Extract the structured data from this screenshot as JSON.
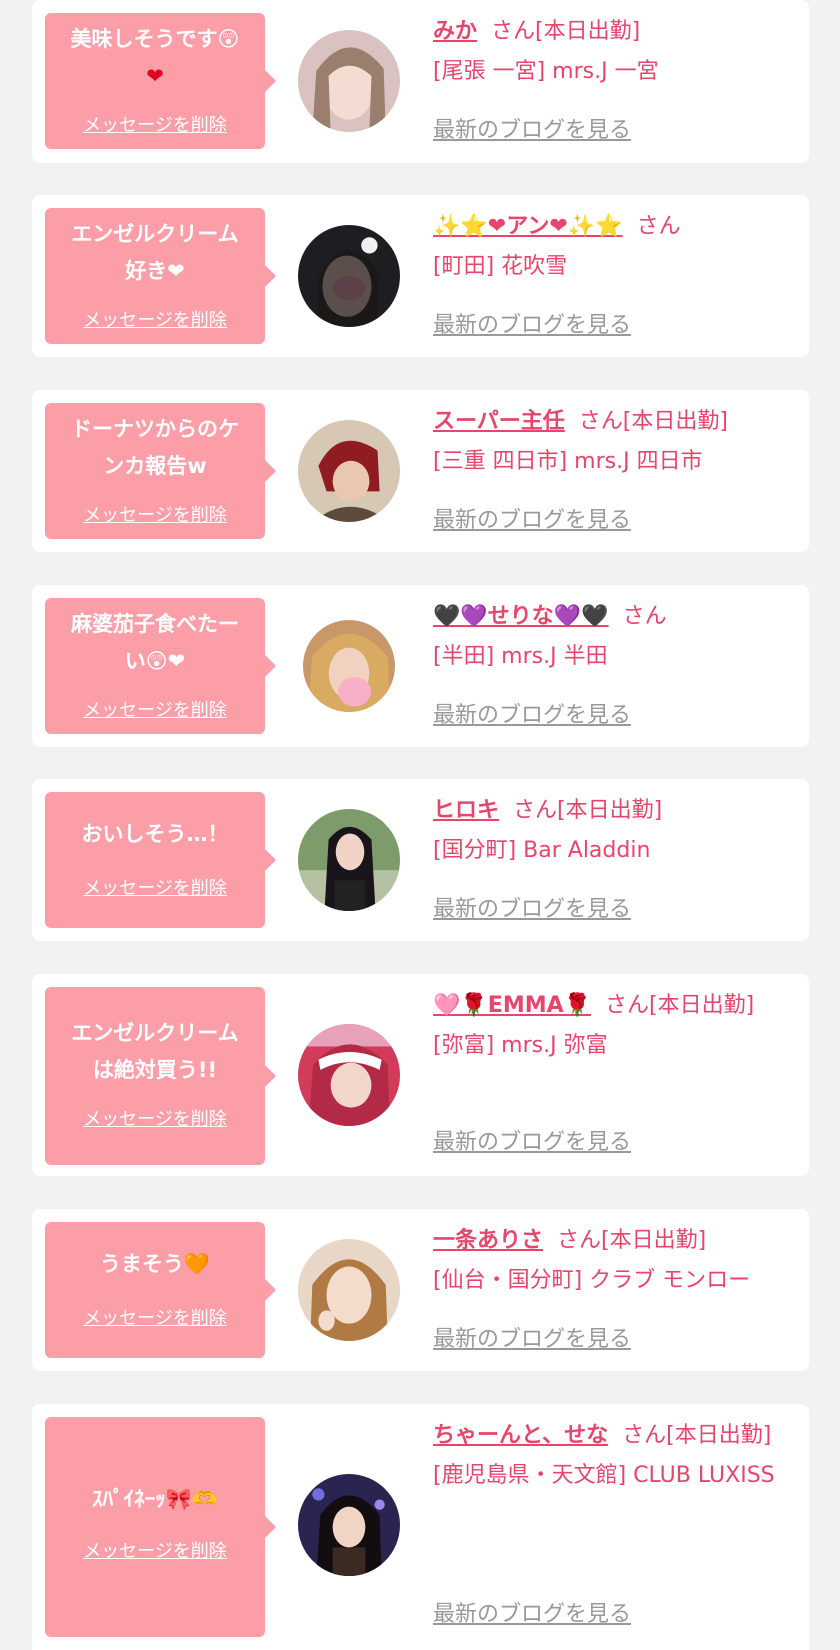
{
  "colors": {
    "page_bg": "#f2f2f2",
    "card_bg": "#ffffff",
    "bubble_bg": "#fc9ea8",
    "name_color": "#e8456b",
    "blog_link_color": "#999999"
  },
  "messages": [
    {
      "comment_lines": [
        "美味しそうです😲",
        "❤"
      ],
      "delete_label": "メッセージを削除",
      "name": "みか",
      "suffix": "さん[本日出勤]",
      "shop_lines": [
        "[尾張 一宮] mrs.J 一宮"
      ],
      "blog_label": "最新のブログを見る",
      "avatar_icon": "avatar-photo"
    },
    {
      "comment_lines": [
        "エンゼルクリーム",
        "好き❤"
      ],
      "delete_label": "メッセージを削除",
      "name": "✨⭐❤アン❤✨⭐",
      "suffix": "さん",
      "shop_lines": [
        "[町田] 花吹雪"
      ],
      "blog_label": "最新のブログを見る",
      "avatar_icon": "avatar-photo"
    },
    {
      "comment_lines": [
        "ドーナツからのケ",
        "ンカ報告w"
      ],
      "delete_label": "メッセージを削除",
      "name": "スーパー主任",
      "suffix": "さん[本日出勤]",
      "shop_lines": [
        "[三重 四日市] mrs.J 四日市"
      ],
      "blog_label": "最新のブログを見る",
      "avatar_icon": "avatar-photo"
    },
    {
      "comment_lines": [
        "麻婆茄子食べたー",
        "い😲❤"
      ],
      "delete_label": "メッセージを削除",
      "name": "🖤💜せりな💜🖤",
      "suffix": "さん",
      "shop_lines": [
        "[半田] mrs.J 半田"
      ],
      "blog_label": "最新のブログを見る",
      "avatar_icon": "avatar-photo"
    },
    {
      "comment_lines": [
        "おいしそう…！"
      ],
      "delete_label": "メッセージを削除",
      "name": "ヒロキ",
      "suffix": "さん[本日出勤]",
      "shop_lines": [
        "[国分町] Bar Aladdin"
      ],
      "blog_label": "最新のブログを見る",
      "avatar_icon": "avatar-photo"
    },
    {
      "comment_lines": [
        "エンゼルクリーム",
        "は絶対買う!!"
      ],
      "delete_label": "メッセージを削除",
      "name": "🩷🌹EMMA🌹",
      "suffix": "さん[本日出勤]",
      "shop_lines": [
        "[弥富] mrs.J 弥富"
      ],
      "blog_label": "最新のブログを見る",
      "avatar_icon": "avatar-photo"
    },
    {
      "comment_lines": [
        "うまそう🧡"
      ],
      "delete_label": "メッセージを削除",
      "name": "一条ありさ",
      "suffix": "さん[本日出勤]",
      "shop_lines": [
        "[仙台・国分町] クラブ モンロー"
      ],
      "blog_label": "最新のブログを見る",
      "avatar_icon": "avatar-photo"
    },
    {
      "comment_lines": [
        "ｽﾊﾟｲﾈｰｯ🎀🫶"
      ],
      "delete_label": "メッセージを削除",
      "name": "ちゃーんと、せな",
      "suffix": "さん[本日出勤]",
      "shop_lines": [
        "[鹿児島県・天文館] CLUB LUXISS"
      ],
      "blog_label": "最新のブログを見る",
      "avatar_icon": "avatar-photo"
    }
  ]
}
